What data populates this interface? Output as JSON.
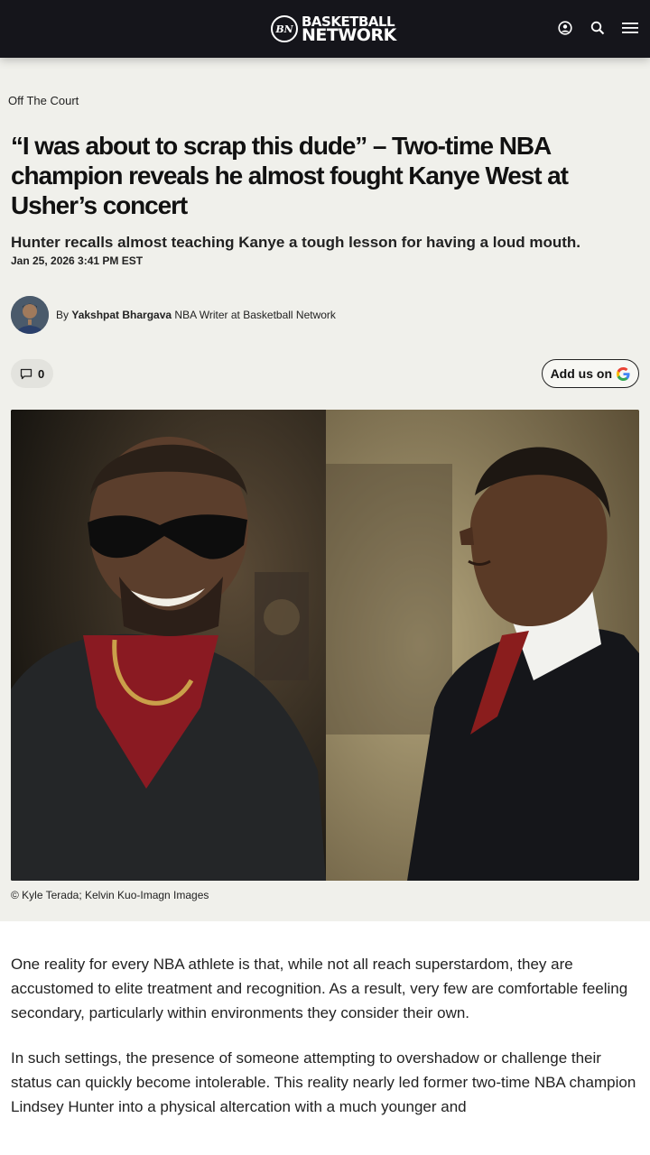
{
  "header": {
    "logo_mark": "BN",
    "logo_line1": "BASKETBALL",
    "logo_line2": "NETWORK",
    "icons": [
      "user-icon",
      "search-icon",
      "menu-icon"
    ]
  },
  "article": {
    "category": "Off The Court",
    "headline": "“I was about to scrap this dude” – Two-time NBA champion reveals he almost fought Kanye West at Usher’s concert",
    "subheadline": "Hunter recalls almost teaching Kanye a tough lesson for having a loud mouth.",
    "date": "Jan 25, 2026 3:41 PM EST",
    "author": {
      "by": "By",
      "name": "Yakshpat Bhargava",
      "title": "NBA Writer at Basketball Network"
    },
    "comments_count": "0",
    "add_us_label": "Add us on",
    "image_caption": "© Kyle Terada; Kelvin Kuo-Imagn Images",
    "paragraphs": [
      "One reality for every NBA athlete is that, while not all reach superstardom, they are accustomed to elite treatment and recognition. As a result, very few are comfortable feeling secondary, particularly within environments they consider their own.",
      "In such settings, the presence of someone attempting to overshadow or challenge their status can quickly become intolerable. This reality nearly led former two-time NBA champion Lindsey Hunter into a physical altercation with a much younger and"
    ]
  },
  "colors": {
    "topbar": "#15151b",
    "head_bg": "#f0f0eb"
  }
}
